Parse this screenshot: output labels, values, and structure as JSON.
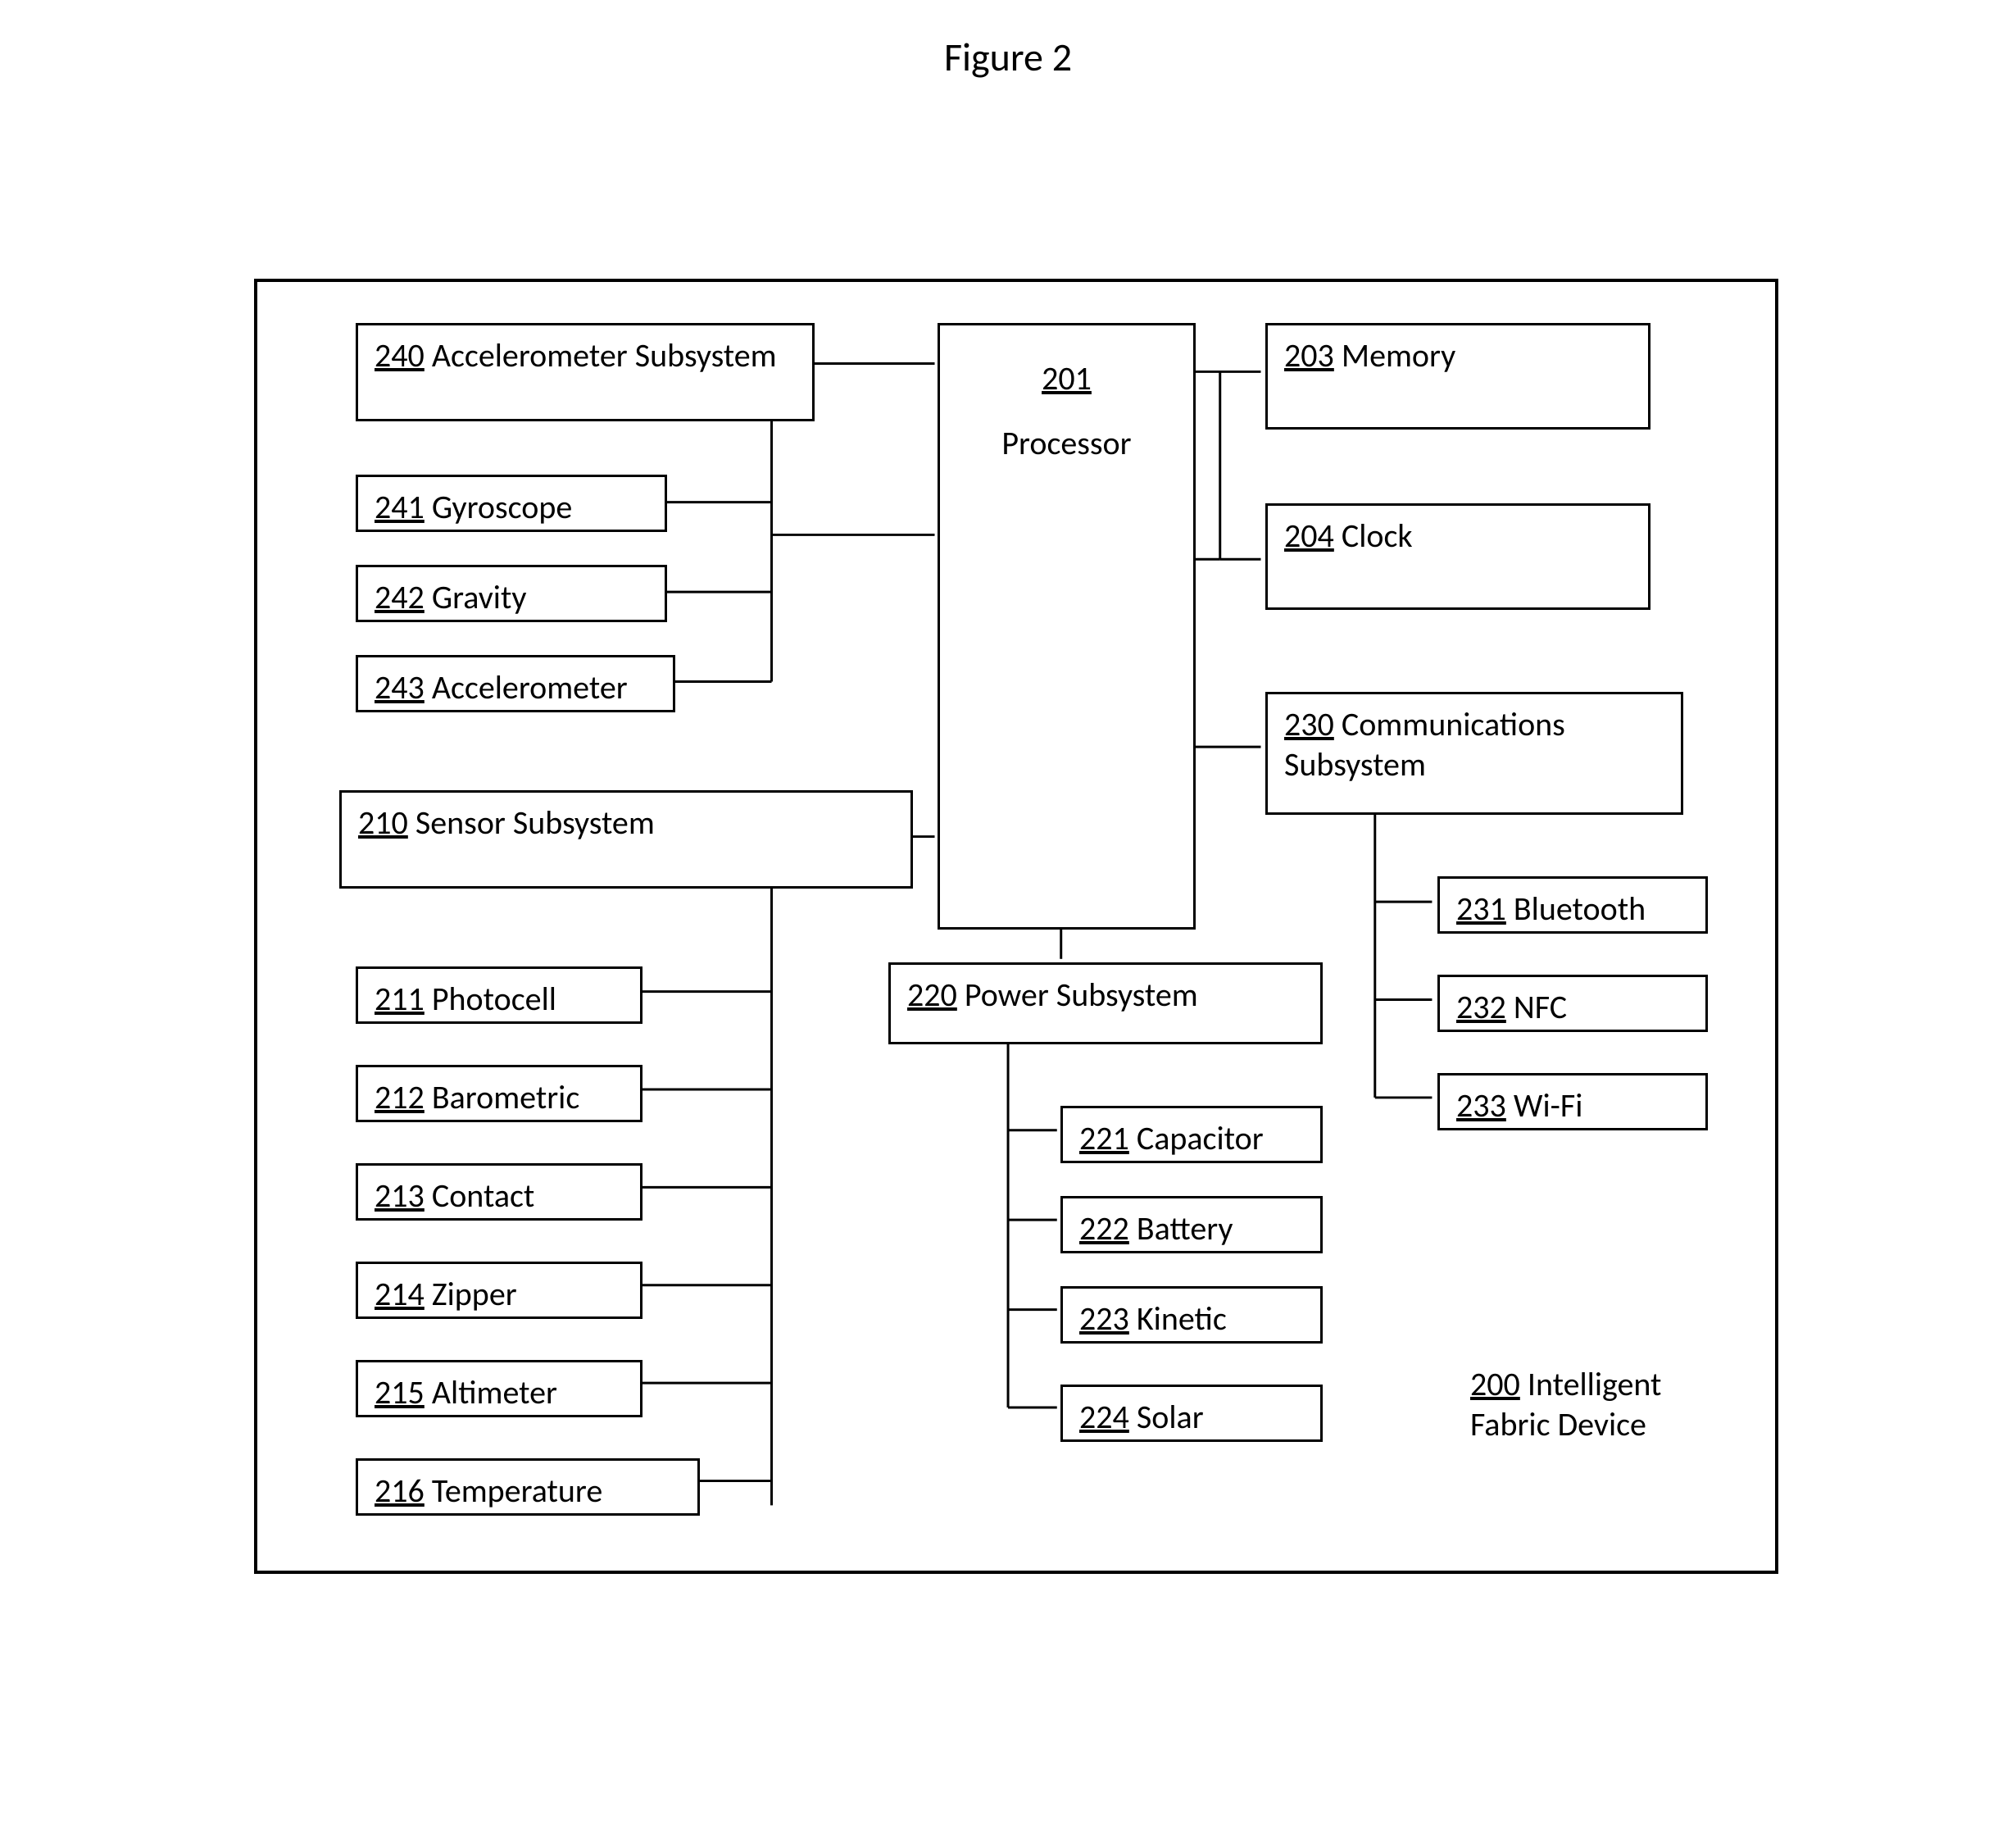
{
  "title": "Figure 2",
  "blocks": {
    "b200": {
      "ref": "200",
      "label": "Intelligent Fabric Device"
    },
    "b201": {
      "ref": "201",
      "label": "Processor"
    },
    "b203": {
      "ref": "203",
      "label": "Memory"
    },
    "b204": {
      "ref": "204",
      "label": "Clock"
    },
    "b210": {
      "ref": "210",
      "label": "Sensor Subsystem"
    },
    "b211": {
      "ref": "211",
      "label": "Photocell"
    },
    "b212": {
      "ref": "212",
      "label": "Barometric"
    },
    "b213": {
      "ref": "213",
      "label": "Contact"
    },
    "b214": {
      "ref": "214",
      "label": "Zipper"
    },
    "b215": {
      "ref": "215",
      "label": "Altimeter"
    },
    "b216": {
      "ref": "216",
      "label": "Temperature"
    },
    "b220": {
      "ref": "220",
      "label": "Power Subsystem"
    },
    "b221": {
      "ref": "221",
      "label": "Capacitor"
    },
    "b222": {
      "ref": "222",
      "label": "Battery"
    },
    "b223": {
      "ref": "223",
      "label": "Kinetic"
    },
    "b224": {
      "ref": "224",
      "label": "Solar"
    },
    "b230": {
      "ref": "230",
      "label": "Communications Subsystem"
    },
    "b231": {
      "ref": "231",
      "label": "Bluetooth"
    },
    "b232": {
      "ref": "232",
      "label": "NFC"
    },
    "b233": {
      "ref": "233",
      "label": "Wi-Fi"
    },
    "b240": {
      "ref": "240",
      "label": "Accelerometer Subsystem"
    },
    "b241": {
      "ref": "241",
      "label": "Gyroscope"
    },
    "b242": {
      "ref": "242",
      "label": "Gravity"
    },
    "b243": {
      "ref": "243",
      "label": "Accelerometer"
    }
  }
}
